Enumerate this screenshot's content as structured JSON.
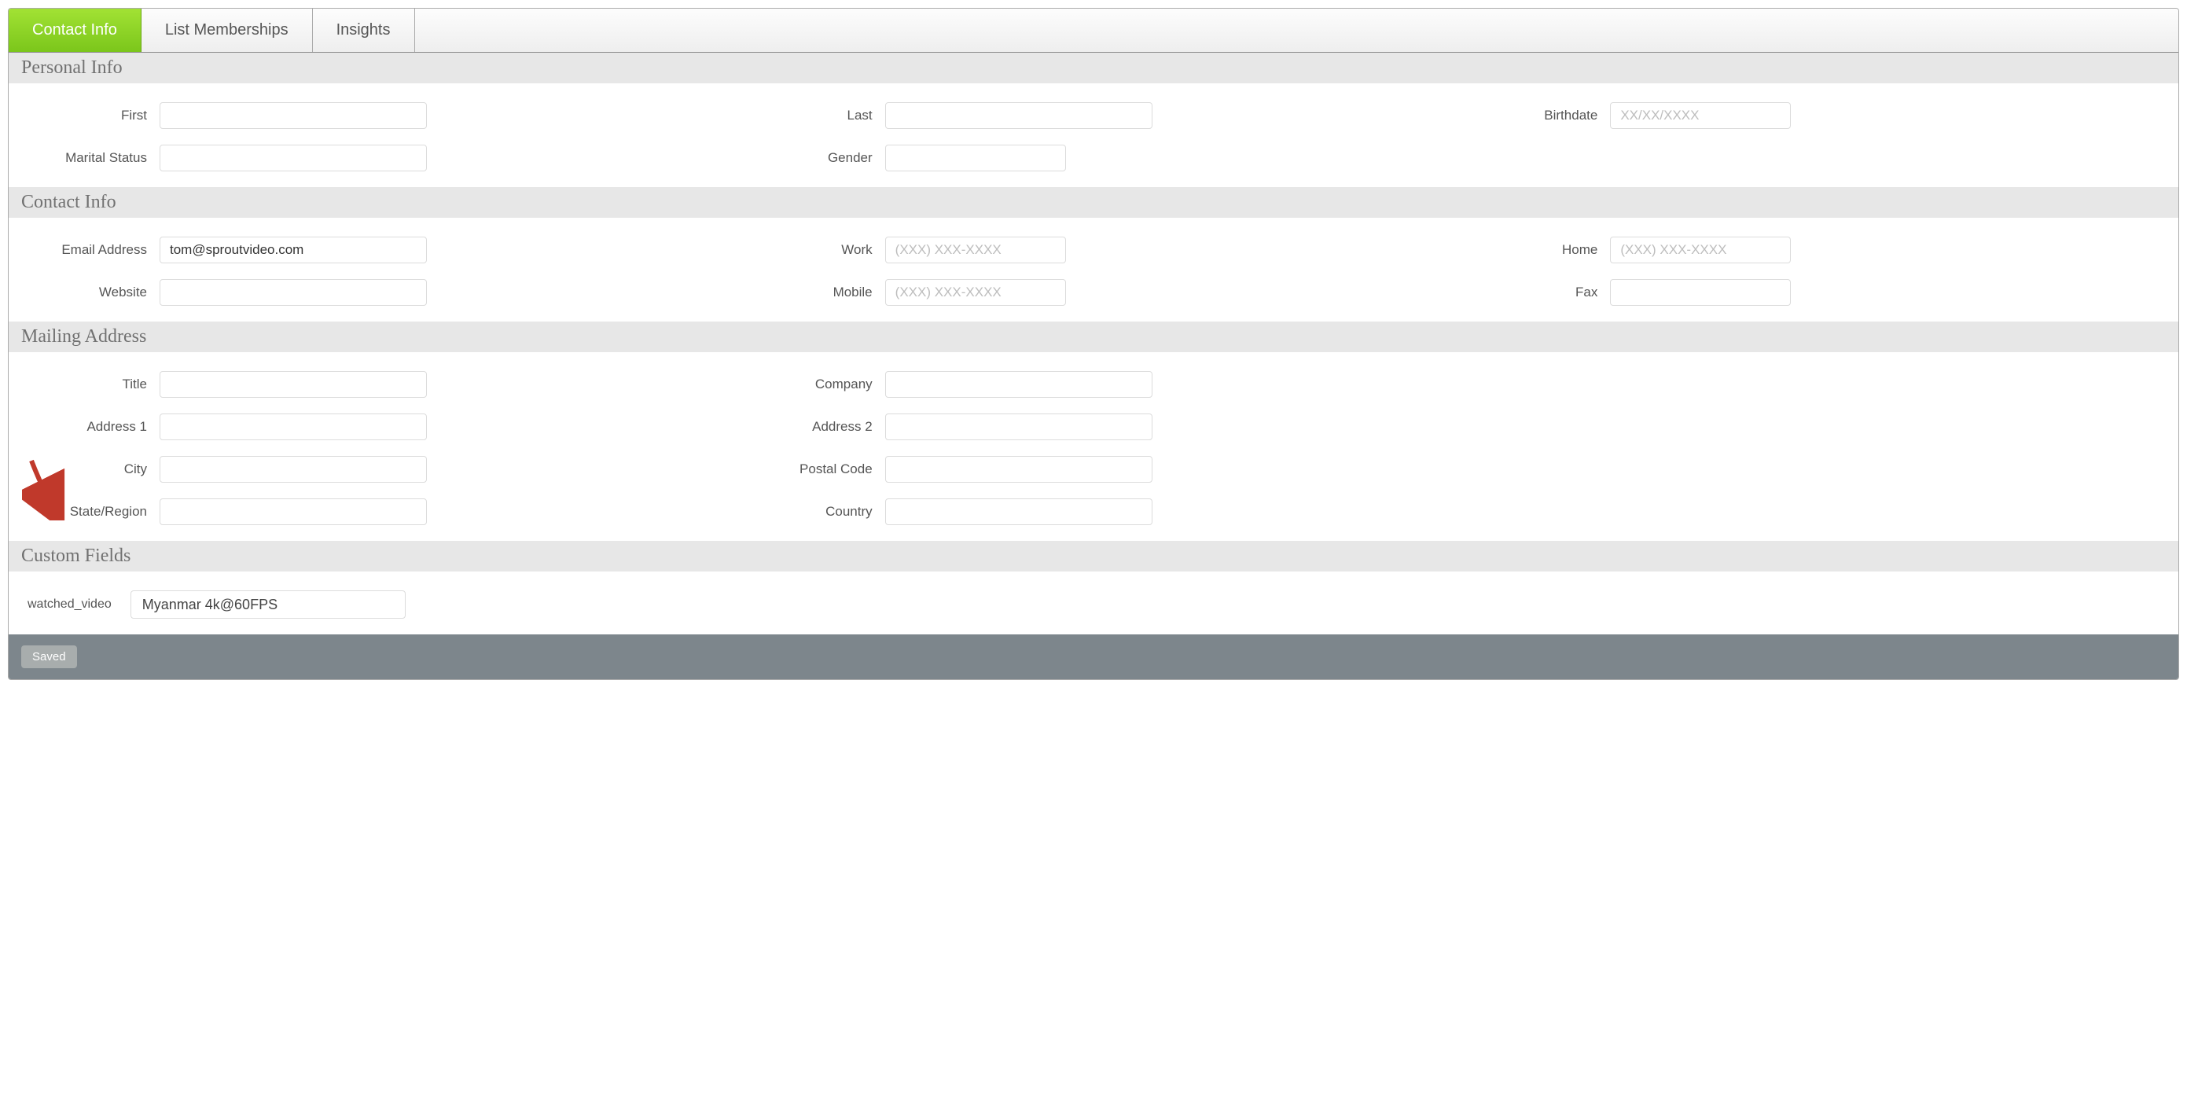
{
  "tabs": {
    "contact_info": "Contact Info",
    "list_memberships": "List Memberships",
    "insights": "Insights"
  },
  "sections": {
    "personal": {
      "header": "Personal Info",
      "first_label": "First",
      "first_value": "",
      "last_label": "Last",
      "last_value": "",
      "birthdate_label": "Birthdate",
      "birthdate_value": "",
      "birthdate_placeholder": "XX/XX/XXXX",
      "marital_label": "Marital Status",
      "marital_value": "",
      "gender_label": "Gender",
      "gender_value": ""
    },
    "contact": {
      "header": "Contact Info",
      "email_label": "Email Address",
      "email_value": "tom@sproutvideo.com",
      "work_label": "Work",
      "work_value": "",
      "work_placeholder": "(XXX) XXX-XXXX",
      "home_label": "Home",
      "home_value": "",
      "home_placeholder": "(XXX) XXX-XXXX",
      "website_label": "Website",
      "website_value": "",
      "mobile_label": "Mobile",
      "mobile_value": "",
      "mobile_placeholder": "(XXX) XXX-XXXX",
      "fax_label": "Fax",
      "fax_value": ""
    },
    "mailing": {
      "header": "Mailing Address",
      "title_label": "Title",
      "title_value": "",
      "company_label": "Company",
      "company_value": "",
      "addr1_label": "Address 1",
      "addr1_value": "",
      "addr2_label": "Address 2",
      "addr2_value": "",
      "city_label": "City",
      "city_value": "",
      "postal_label": "Postal Code",
      "postal_value": "",
      "state_label": "State/Region",
      "state_value": "",
      "country_label": "Country",
      "country_value": ""
    },
    "custom": {
      "header": "Custom Fields",
      "watched_video_label": "watched_video",
      "watched_video_value": "Myanmar 4k@60FPS"
    }
  },
  "footer": {
    "saved_label": "Saved"
  },
  "annotation": {
    "arrow_color": "#c0392b"
  }
}
